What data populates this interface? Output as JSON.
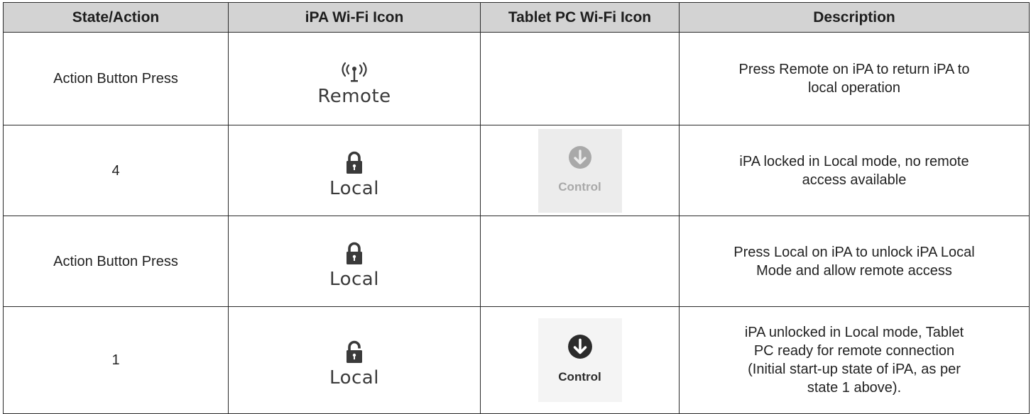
{
  "headers": {
    "state_action": "State/Action",
    "ipa_icon": "iPA Wi-Fi Icon",
    "tablet_icon": "Tablet PC Wi-Fi Icon",
    "description": "Description"
  },
  "rows": [
    {
      "state": "Action Button Press",
      "ipa_icon": {
        "name": "antenna-icon",
        "label": "Remote"
      },
      "tablet_icon": null,
      "description": [
        "Press Remote on iPA to return iPA to",
        "local operation"
      ]
    },
    {
      "state": "4",
      "ipa_icon": {
        "name": "lock-closed-icon",
        "label": "Local"
      },
      "tablet_icon": {
        "name": "download-arrow-icon",
        "label": "Control",
        "state": "disabled"
      },
      "description": [
        "iPA locked in Local mode, no remote",
        "access available"
      ]
    },
    {
      "state": "Action Button Press",
      "ipa_icon": {
        "name": "lock-closed-icon",
        "label": "Local"
      },
      "tablet_icon": null,
      "description": [
        "Press Local on iPA to unlock iPA Local",
        "Mode and allow remote access"
      ]
    },
    {
      "state": "1",
      "ipa_icon": {
        "name": "lock-open-icon",
        "label": "Local"
      },
      "tablet_icon": {
        "name": "download-arrow-icon",
        "label": "Control",
        "state": "active"
      },
      "description": [
        "iPA unlocked in Local mode, Tablet",
        "PC ready for remote connection",
        "(Initial start-up state of iPA, as per",
        "state 1 above)."
      ]
    }
  ],
  "colors": {
    "header_bg": "#d3d3d3",
    "border": "#2a2a2a",
    "icon_gray": "#3a3a3a",
    "control_disabled_bg": "#ececec",
    "control_disabled_fg": "#a9a9a9"
  }
}
